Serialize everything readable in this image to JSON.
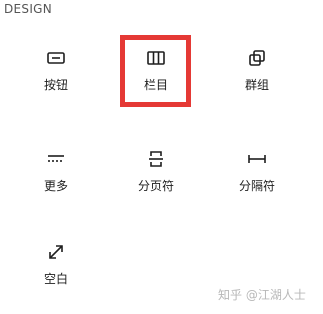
{
  "section": {
    "title": "DESIGN"
  },
  "blocks": [
    {
      "label": "按钮",
      "icon": "button-icon"
    },
    {
      "label": "栏目",
      "icon": "columns-icon"
    },
    {
      "label": "群组",
      "icon": "group-icon"
    },
    {
      "label": "更多",
      "icon": "more-icon"
    },
    {
      "label": "分页符",
      "icon": "page-break-icon"
    },
    {
      "label": "分隔符",
      "icon": "separator-icon"
    },
    {
      "label": "空白",
      "icon": "spacer-icon"
    }
  ],
  "watermark": {
    "text": "知乎 @江湖人士"
  },
  "colors": {
    "highlight": "#e53935",
    "text": "#1e1e1e",
    "watermark": "#b8b8b8"
  }
}
